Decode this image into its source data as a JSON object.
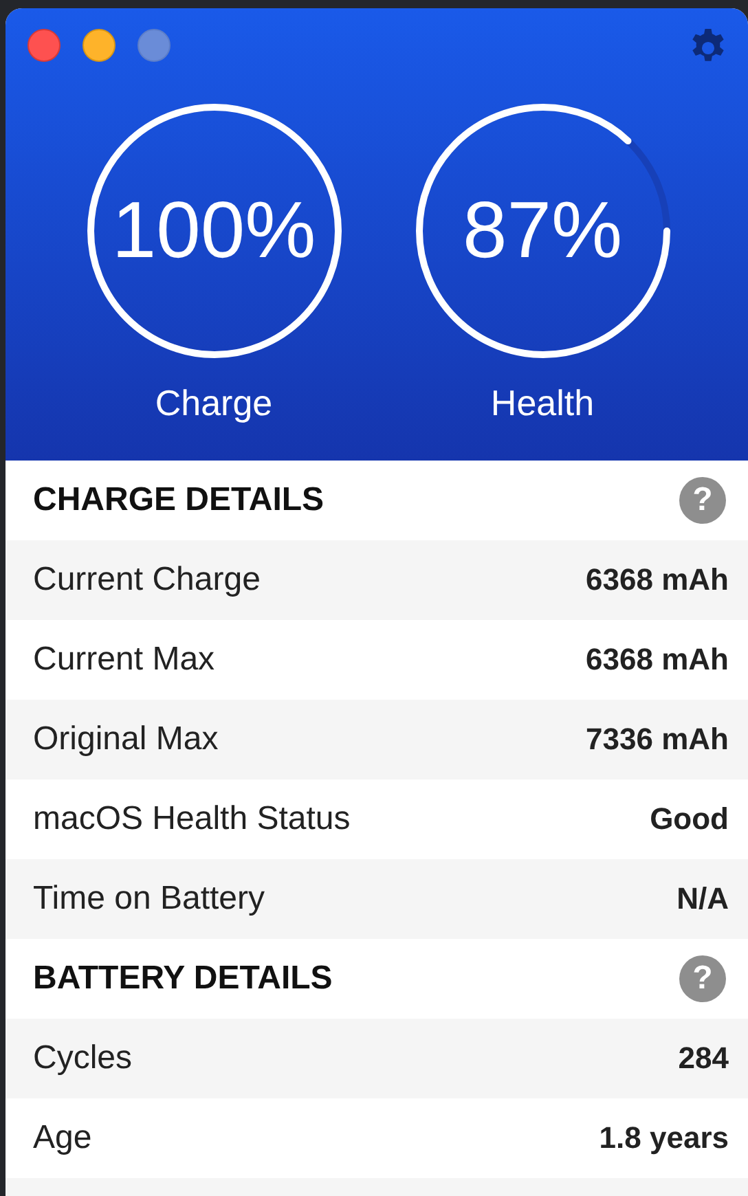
{
  "gauges": [
    {
      "value": "100%",
      "label": "Charge"
    },
    {
      "value": "87%",
      "label": "Health"
    }
  ],
  "sections": [
    {
      "title": "CHARGE DETAILS",
      "help": "?",
      "rows": [
        {
          "label": "Current Charge",
          "value": "6368 mAh"
        },
        {
          "label": "Current Max",
          "value": "6368 mAh"
        },
        {
          "label": "Original Max",
          "value": "7336 mAh"
        },
        {
          "label": "macOS Health Status",
          "value": "Good"
        },
        {
          "label": "Time on Battery",
          "value": "N/A"
        }
      ]
    },
    {
      "title": "BATTERY DETAILS",
      "help": "?",
      "rows": [
        {
          "label": "Cycles",
          "value": "284"
        },
        {
          "label": "Age",
          "value": "1.8 years"
        }
      ]
    }
  ]
}
